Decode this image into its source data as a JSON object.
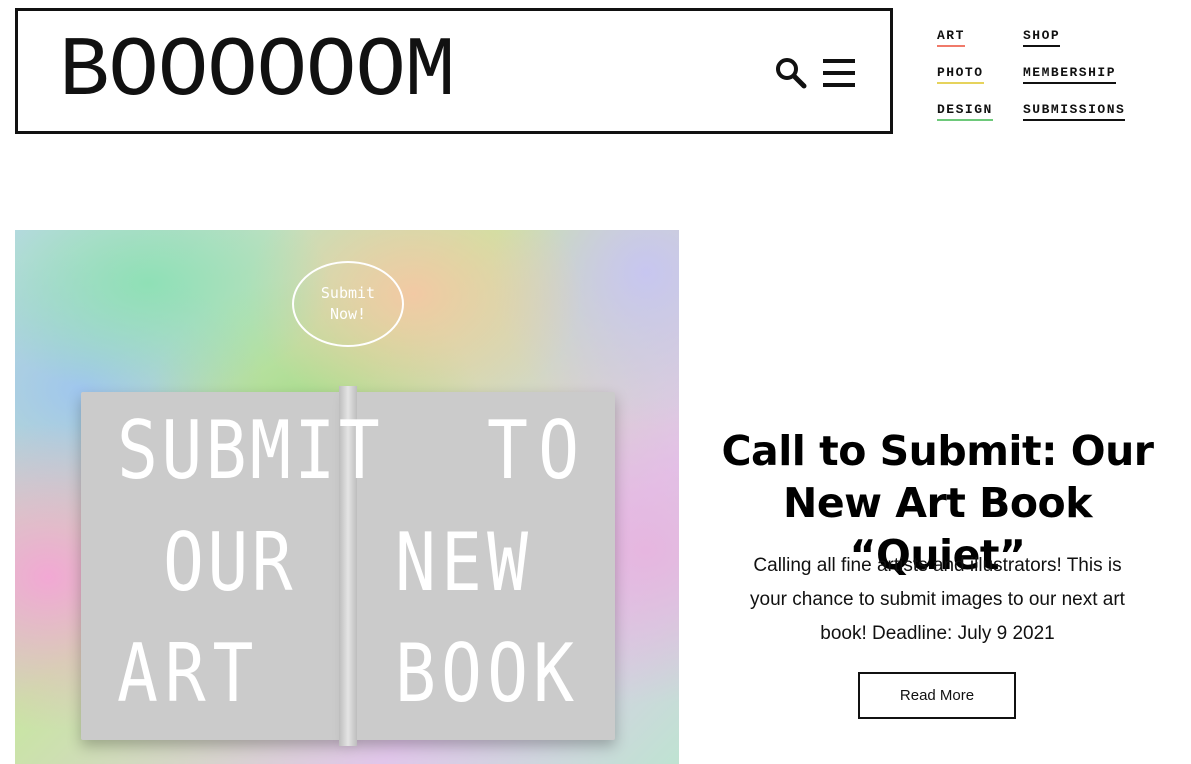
{
  "header": {
    "logo": "BOOOOOOM",
    "search_icon": "search-icon",
    "menu_icon": "hamburger-menu-icon"
  },
  "nav": {
    "categories": [
      {
        "label": "ART",
        "color": "#f07a6a"
      },
      {
        "label": "PHOTO",
        "color": "#e6d35c"
      },
      {
        "label": "DESIGN",
        "color": "#6dc97a"
      },
      {
        "label": "SHOP",
        "color": "#111111"
      },
      {
        "label": "MEMBERSHIP",
        "color": "#111111"
      },
      {
        "label": "SUBMISSIONS",
        "color": "#111111"
      }
    ]
  },
  "feature": {
    "badge": [
      "Submit",
      "Now!"
    ],
    "book_words": [
      "SUBMIT",
      "TO",
      "OUR",
      "NEW",
      "ART",
      "BOOK"
    ]
  },
  "article": {
    "title": "Call to Submit: Our New Art Book “Quiet”",
    "excerpt": "Calling all fine artists and illustrators! This is your chance to submit images to our next art book! Deadline: July 9 2021",
    "read_more": "Read More"
  }
}
